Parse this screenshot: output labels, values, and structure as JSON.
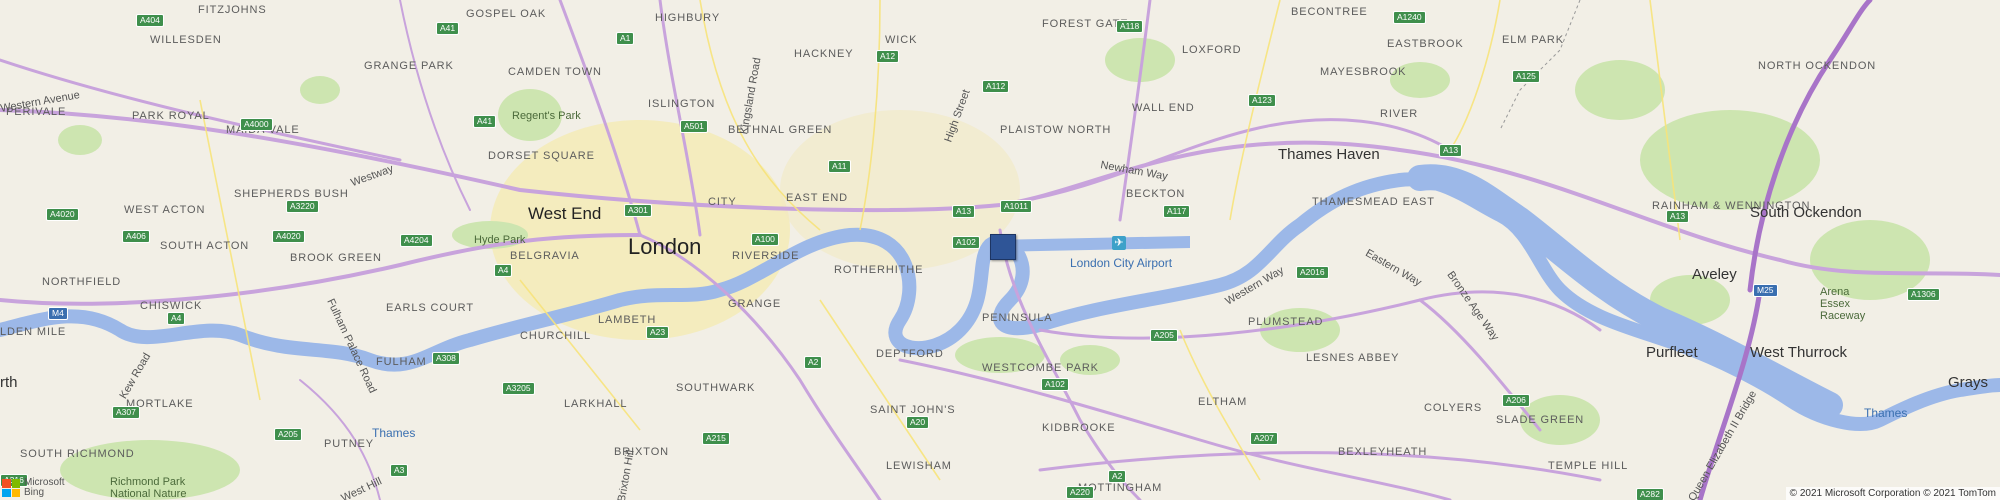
{
  "map": {
    "copyright": "© 2021 Microsoft Corporation © 2021 TomTom",
    "logo": {
      "line1": "Microsoft",
      "line2": "Bing"
    },
    "pin_name": "location-pin",
    "airport_icon": "airplane-icon",
    "colors": {
      "land": "#f2efe6",
      "water": "#9cb8e8",
      "park": "#cde5b0",
      "major_road": "#c8a3dc",
      "motorway": "#a874c8",
      "urban": "#f3e7a0"
    },
    "labels": {
      "fitzjohns": "FITZJOHNS",
      "gospel_oak": "GOSPEL OAK",
      "highbury": "HIGHBURY",
      "wick": "WICK",
      "forest_gate": "FOREST GATE",
      "loxford": "LOXFORD",
      "becontree": "BECONTREE",
      "willesden": "WILLESDEN",
      "hackney": "HACKNEY",
      "eastbrook": "EASTBROOK",
      "elm_park": "ELM PARK",
      "north_ockendon": "NORTH OCKENDON",
      "perivale": "PERIVALE",
      "grange_park": "GRANGE PARK",
      "camden_town": "CAMDEN TOWN",
      "islington": "ISLINGTON",
      "mayesbrook": "MAYESBROOK",
      "wall_end": "WALL END",
      "park_royal": "PARK ROYAL",
      "regents_park": "Regent's Park",
      "bethnal_green": "BETHNAL GREEN",
      "plaistow_north": "PLAISTOW NORTH",
      "river": "RIVER",
      "maida_vale": "MAIDA VALE",
      "dorset_square": "DORSET SQUARE",
      "thames_haven": "Thames Haven",
      "shepherds_bush": "SHEPHERDS BUSH",
      "west_end": "West End",
      "city": "CITY",
      "east_end": "EAST END",
      "beckton": "BECKTON",
      "rainham_wennington": "RAINHAM & WENNINGTON",
      "south_ockendon": "South Ockendon",
      "west_acton": "WEST ACTON",
      "thamesmead_east": "THAMESMEAD EAST",
      "south_acton": "SOUTH ACTON",
      "hyde_park": "Hyde Park",
      "london": "London",
      "riverside": "RIVERSIDE",
      "rotherhithe": "ROTHERHITHE",
      "london_city_airport": "London City Airport",
      "northfield": "NORTHFIELD",
      "brook_green": "BROOK GREEN",
      "belgravia": "BELGRAVIA",
      "aveley": "Aveley",
      "arena_essex": "Arena Essex Raceway",
      "chiswick": "CHISWICK",
      "earls_court": "EARLS COURT",
      "grange": "GRANGE",
      "peninsula": "PENINSULA",
      "plumstead": "PLUMSTEAD",
      "lambeth": "LAMBETH",
      "golden_mile": "LDEN MILE",
      "churchill": "CHURCHILL",
      "lesnes_abbey": "LESNES ABBEY",
      "purfleet": "Purfleet",
      "west_thurrock": "West Thurrock",
      "fulham": "FULHAM",
      "deptford": "DEPTFORD",
      "westcombe_park": "WESTCOMBE PARK",
      "rth": "rth",
      "grays": "Grays",
      "southwark": "SOUTHWARK",
      "mortlake": "MORTLAKE",
      "larkhall": "LARKHALL",
      "saint_johns": "SAINT JOHN'S",
      "eltham": "ELTHAM",
      "colyers": "COLYERS",
      "slade_green": "SLADE GREEN",
      "kidbrooke": "KIDBROOKE",
      "thames_w": "Thames",
      "thames_e": "Thames",
      "putney": "PUTNEY",
      "south_richmond": "SOUTH RICHMOND",
      "brixton": "BRIXTON",
      "bexleyheath": "BEXLEYHEATH",
      "temple_hill": "TEMPLE HILL",
      "lewisham": "LEWISHAM",
      "richmond_park": "Richmond Park National Nature",
      "mottingham": "MOTTINGHAM",
      "western_avenue": "Western Avenue",
      "westway": "Westway",
      "kingsland_road": "Kingsland Road",
      "high_street": "High Street",
      "newham_way": "Newham Way",
      "western_way": "Western Way",
      "eastern_way": "Eastern Way",
      "bronze_age_way": "Bronze Age Way",
      "fulham_palace_road": "Fulham Palace Road",
      "kew_road": "Kew Road",
      "west_hill": "West Hill",
      "brixton_hill": "Brixton Hill",
      "qe_bridge": "Queen Elizabeth II Bridge"
    },
    "shields": {
      "a404": "A404",
      "a41": "A41",
      "a1": "A1",
      "a12": "A12",
      "a118": "A118",
      "a1240": "A1240",
      "a125": "A125",
      "a112": "A112",
      "a123": "A123",
      "a4000": "A4000",
      "a501": "A501",
      "a13w": "A13",
      "a11": "A11",
      "a1011": "A1011",
      "a13e": "A13",
      "a13f": "A13",
      "a117": "A117",
      "a4020": "A4020",
      "a3220": "A3220",
      "a301": "A301",
      "a406": "A406",
      "a4020b": "A4020",
      "a4204": "A4204",
      "a100": "A100",
      "a102": "A102",
      "a2016": "A2016",
      "a4": "A4",
      "a4b": "A4",
      "m4": "M4",
      "m25": "M25",
      "a1306": "A1306",
      "a205": "A205",
      "a23": "A23",
      "a308": "A308",
      "a3205": "A3205",
      "a2": "A2",
      "a307": "A307",
      "a102b": "A102",
      "a20": "A20",
      "a206": "A206",
      "a205b": "A205",
      "a3": "A3",
      "a215": "A215",
      "a207": "A207",
      "a2b": "A2",
      "a220": "A220",
      "a282": "A282",
      "a316": "A316"
    }
  }
}
